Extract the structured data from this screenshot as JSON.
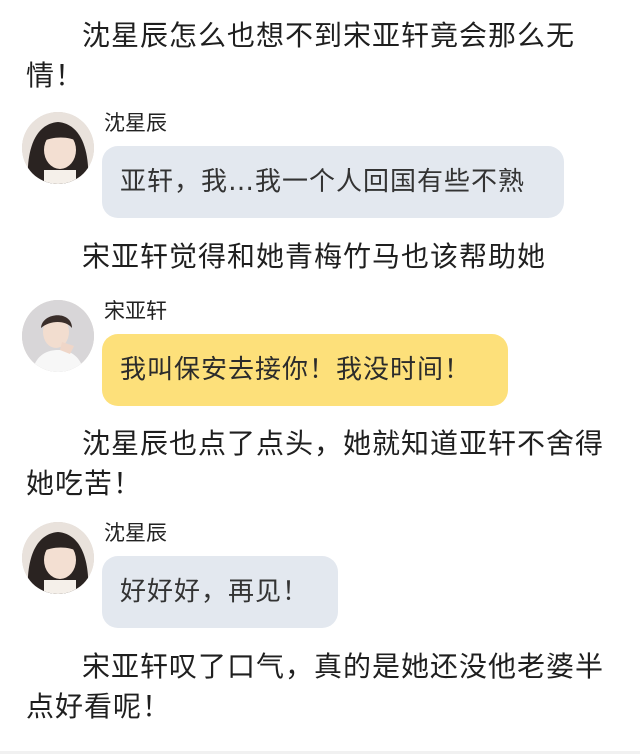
{
  "story": [
    {
      "type": "narration",
      "text": "沈星辰怎么也想不到宋亚轩竟会那么无情！"
    },
    {
      "type": "message",
      "sender": "沈星辰",
      "avatar": "girl-avatar",
      "bubble_color": "#e3e8ef",
      "text": "亚轩，我…我一个人回国有些不熟"
    },
    {
      "type": "narration",
      "text": "宋亚轩觉得和她青梅竹马也该帮助她"
    },
    {
      "type": "message",
      "sender": "宋亚轩",
      "avatar": "boy-avatar",
      "bubble_color": "#fde07a",
      "text": "我叫保安去接你！我没时间！"
    },
    {
      "type": "narration",
      "text": "沈星辰也点了点头，她就知道亚轩不舍得她吃苦！"
    },
    {
      "type": "message",
      "sender": "沈星辰",
      "avatar": "girl-avatar",
      "bubble_color": "#e3e8ef",
      "text": "好好好，再见！"
    },
    {
      "type": "narration",
      "text": "宋亚轩叹了口气，真的是她还没他老婆半点好看呢！"
    }
  ]
}
